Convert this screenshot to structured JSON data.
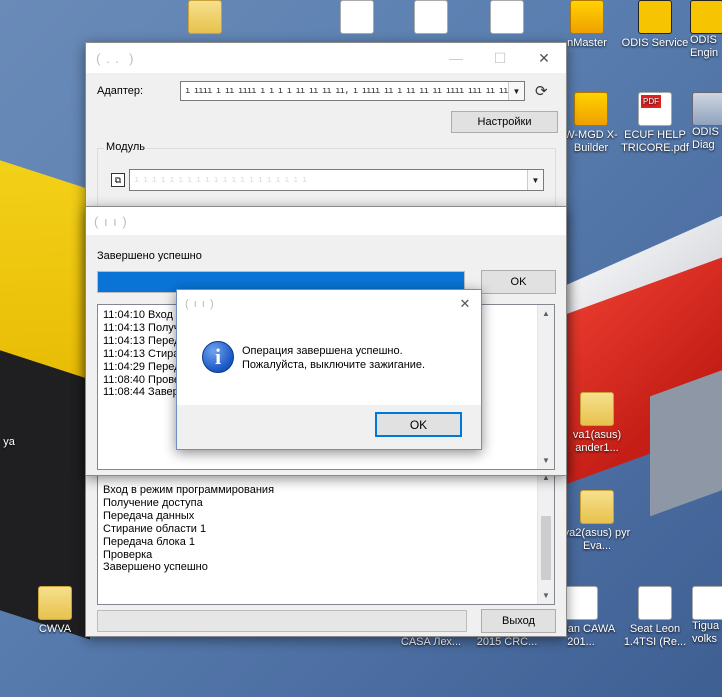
{
  "desktop": {
    "icons": [
      {
        "id": "top1",
        "label": "",
        "type": "folder"
      },
      {
        "id": "top2",
        "label": "",
        "type": "doc"
      },
      {
        "id": "top3",
        "label": "",
        "type": "doc"
      },
      {
        "id": "top4",
        "label": "",
        "type": "doc"
      },
      {
        "id": "vasmaster",
        "label": "nMaster",
        "type": "shield"
      },
      {
        "id": "odis-service",
        "label": "ODIS Service",
        "type": "odis"
      },
      {
        "id": "odis-engineering",
        "label": "ODIS Engin",
        "type": "odis"
      },
      {
        "id": "mgd-builder",
        "label": "W-MGD X-Builder",
        "type": "shield"
      },
      {
        "id": "ecuf-help",
        "label": "ECUF HELP TRICORE.pdf",
        "type": "pdf"
      },
      {
        "id": "odis-diag",
        "label": "ODIS Diag",
        "type": "app"
      },
      {
        "id": "eva1",
        "label": "va1(asus) ander1...",
        "type": "folder"
      },
      {
        "id": "eva2",
        "label": "va2(asus) pyr Eva...",
        "type": "folder"
      },
      {
        "id": "left-ya",
        "label": "ya",
        "type": "none"
      },
      {
        "id": "cwva",
        "label": "CWVA",
        "type": "folder"
      },
      {
        "id": "casa",
        "label": "CASA Лех...",
        "type": "none"
      },
      {
        "id": "crc",
        "label": "2015 CRC...",
        "type": "none"
      },
      {
        "id": "tiguan",
        "label": "Tiguan CAWA 201...",
        "type": "doc"
      },
      {
        "id": "seat-leon",
        "label": "Seat Leon 1.4TSI (Re...",
        "type": "doc"
      },
      {
        "id": "tigua-volks",
        "label": "Tigua volks",
        "type": "doc"
      }
    ]
  },
  "main_window": {
    "title": " ( . .  )",
    "adapter_label": "Адаптер:",
    "adapter_value": "ı ıııı ı ıı ıııı ı ı ı ı ıı ıı ıı ıı, ı ıııı ıı ı ıı ıı ıı ıııı ııı ıı ıı ıı ıı ı ı ı ı ı ı",
    "settings_button": "Настройки",
    "module_group_label": "Модуль",
    "module_value": "ı ı ı ı ı ı ı ı ı ı ı ı ı ı ı ı ı ı ı ı",
    "log_lines": [
      "Вход в режим программирования",
      "Получение доступа",
      "Передача данных",
      "Стирание области 1",
      "Передача блока 1",
      "Проверка",
      "Завершено успешно"
    ],
    "exit_button": "Выход"
  },
  "progress_window": {
    "title": "( ı ı )",
    "status_label": "Завершено успешно",
    "progress_percent": 100,
    "ok_button": "OK",
    "log_lines": [
      "11:04:10 Вход",
      "11:04:13 Получ",
      "11:04:13 Перед",
      "11:04:13 Стира",
      "11:04:29 Перед",
      "11:08:40 Прове",
      "11:08:44 Завер"
    ]
  },
  "message_box": {
    "title": "( ı ı )",
    "icon": "info-icon",
    "line1": "Операция завершена успешно.",
    "line2": "Пожалуйста, выключите зажигание.",
    "ok_button": "OK"
  }
}
